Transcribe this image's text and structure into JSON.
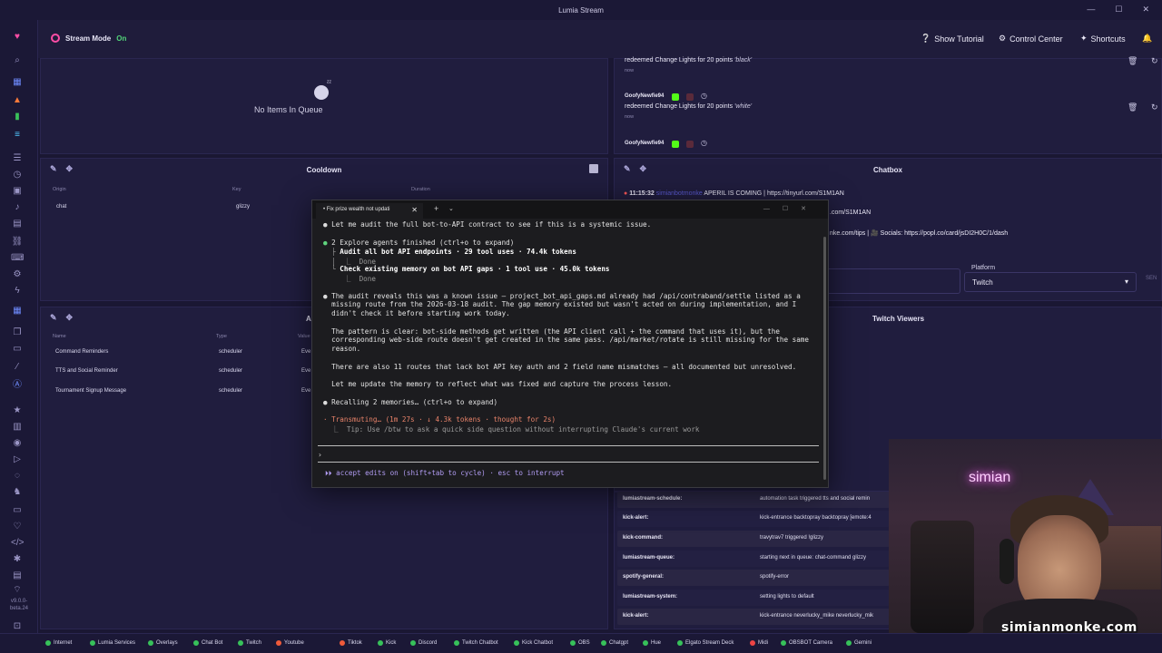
{
  "app": {
    "title": "Lumia Stream",
    "version": "v9.0.0-beta.24"
  },
  "topbar": {
    "stream_mode_label": "Stream Mode",
    "stream_mode_state": "On",
    "show_tutorial": "Show Tutorial",
    "control_center": "Control Center",
    "shortcuts": "Shortcuts"
  },
  "queue": {
    "empty_text": "No Items In Queue"
  },
  "cooldown": {
    "title": "Cooldown",
    "columns": [
      "Origin",
      "Key",
      "Duration"
    ],
    "rows": [
      {
        "origin": "chat",
        "key": "glizzy",
        "duration": ""
      }
    ]
  },
  "scheduler": {
    "title": "A",
    "columns": [
      "Name",
      "Type",
      "Value"
    ],
    "rows": [
      {
        "name": "Command Reminders",
        "type": "scheduler",
        "value": "Eve"
      },
      {
        "name": "TTS and Social Reminder",
        "type": "scheduler",
        "value": "Eve"
      },
      {
        "name": "Tournament Signup Message",
        "type": "scheduler",
        "value": "Eve"
      }
    ]
  },
  "redemptions": [
    {
      "user": "",
      "text": "redeemed Change Lights for 20 points",
      "value": "'black'",
      "time": "now"
    },
    {
      "user": "GoofyNewfie94",
      "text": "redeemed Change Lights for 20 points",
      "value": "'white'",
      "time": "now"
    },
    {
      "user": "GoofyNewfie94",
      "text": "",
      "value": "",
      "time": ""
    }
  ],
  "chatbox": {
    "title": "Chatbox",
    "lines": [
      {
        "time": "11:15:32",
        "user": "simianbotmonke",
        "text": "APERIL IS COMING | https://tinyurl.com/S1M1AN"
      },
      {
        "time": "",
        "user": "",
        "text": ".com/S1M1AN"
      },
      {
        "time": "",
        "user": "",
        "text": "nke.com/tips | 🎥 Socials: https://popl.co/card/jsDI2H0C/1/dash"
      }
    ],
    "platform_label": "Platform",
    "platform_value": "Twitch",
    "send_label": "SEN"
  },
  "twitch_viewers": {
    "title": "Twitch Viewers"
  },
  "events": [
    {
      "source": "lumiastream-schedule:",
      "text": "automation task triggered tts and social remin"
    },
    {
      "source": "kick-alert:",
      "text": "kick-entrance backtopray backtopray [emote:4"
    },
    {
      "source": "kick-command:",
      "text": "travytrav7 triggered !glizzy"
    },
    {
      "source": "lumiastream-queue:",
      "text": "starting next in queue: chat-command glizzy"
    },
    {
      "source": "spotify-general:",
      "text": "spotify-error"
    },
    {
      "source": "lumiastream-system:",
      "text": "setting lights to default"
    },
    {
      "source": "kick-alert:",
      "text": "kick-entrance neverlucky_mike neverlucky_mik"
    }
  ],
  "terminal": {
    "tab_title": "• Fix prize wealth not updati",
    "lines": [
      "Let me audit the full bot-to-API contract to see if this is a systemic issue.",
      "2 Explore agents finished (ctrl+o to expand)",
      "Audit all bot API endpoints · 29 tool uses · 74.4k tokens",
      "Done",
      "Check existing memory on bot API gaps · 1 tool use · 45.0k tokens",
      "Done",
      "The audit reveals this was a known issue — project_bot_api_gaps.md already had /api/contraband/settle listed as a",
      "missing route from the 2026-03-18 audit. The gap memory existed but wasn't acted on during implementation, and I",
      "didn't check it before starting work today.",
      "The pattern is clear: bot-side methods get written (the API client call + the command that uses it), but the",
      "corresponding web-side route doesn't get created in the same pass. /api/market/rotate is still missing for the same",
      "reason.",
      "There are also 11 routes that lack bot API key auth and 2 field name mismatches — all documented but unresolved.",
      "Let me update the memory to reflect what was fixed and capture the process lesson.",
      "Recalling 2 memories… (ctrl+o to expand)",
      "Transmuting… (1m 27s · ↓ 4.3k tokens · thought for 2s)",
      "Tip: Use /btw to ask a quick side question without interrupting Claude's current work",
      "accept edits on (shift+tab to cycle) · esc to interrupt"
    ]
  },
  "webcam": {
    "neon": "simian",
    "watermark": "simianmonke.com"
  },
  "footer": [
    {
      "label": "Internet",
      "status": "ok"
    },
    {
      "label": "Lumia Services",
      "status": "ok"
    },
    {
      "label": "Overlays",
      "status": "ok"
    },
    {
      "label": "Chat Bot",
      "status": "ok"
    },
    {
      "label": "Twitch",
      "status": "ok"
    },
    {
      "label": "Youtube",
      "status": "warn"
    },
    {
      "label": "Tiktok",
      "status": "warn"
    },
    {
      "label": "Kick",
      "status": "ok"
    },
    {
      "label": "Discord",
      "status": "ok"
    },
    {
      "label": "Twitch Chatbot",
      "status": "ok"
    },
    {
      "label": "Kick Chatbot",
      "status": "ok"
    },
    {
      "label": "OBS",
      "status": "ok"
    },
    {
      "label": "Chatgpt",
      "status": "ok"
    },
    {
      "label": "Hue",
      "status": "ok"
    },
    {
      "label": "Elgato Stream Deck",
      "status": "ok"
    },
    {
      "label": "Midi",
      "status": "err"
    },
    {
      "label": "OBSBOT Camera",
      "status": "ok"
    },
    {
      "label": "Gemini",
      "status": "ok"
    }
  ],
  "colors": {
    "bg": "#1a1733",
    "panel": "#201d3e",
    "accent": "#ff4da6",
    "ok": "#37c15a",
    "warn": "#f05a3a"
  }
}
